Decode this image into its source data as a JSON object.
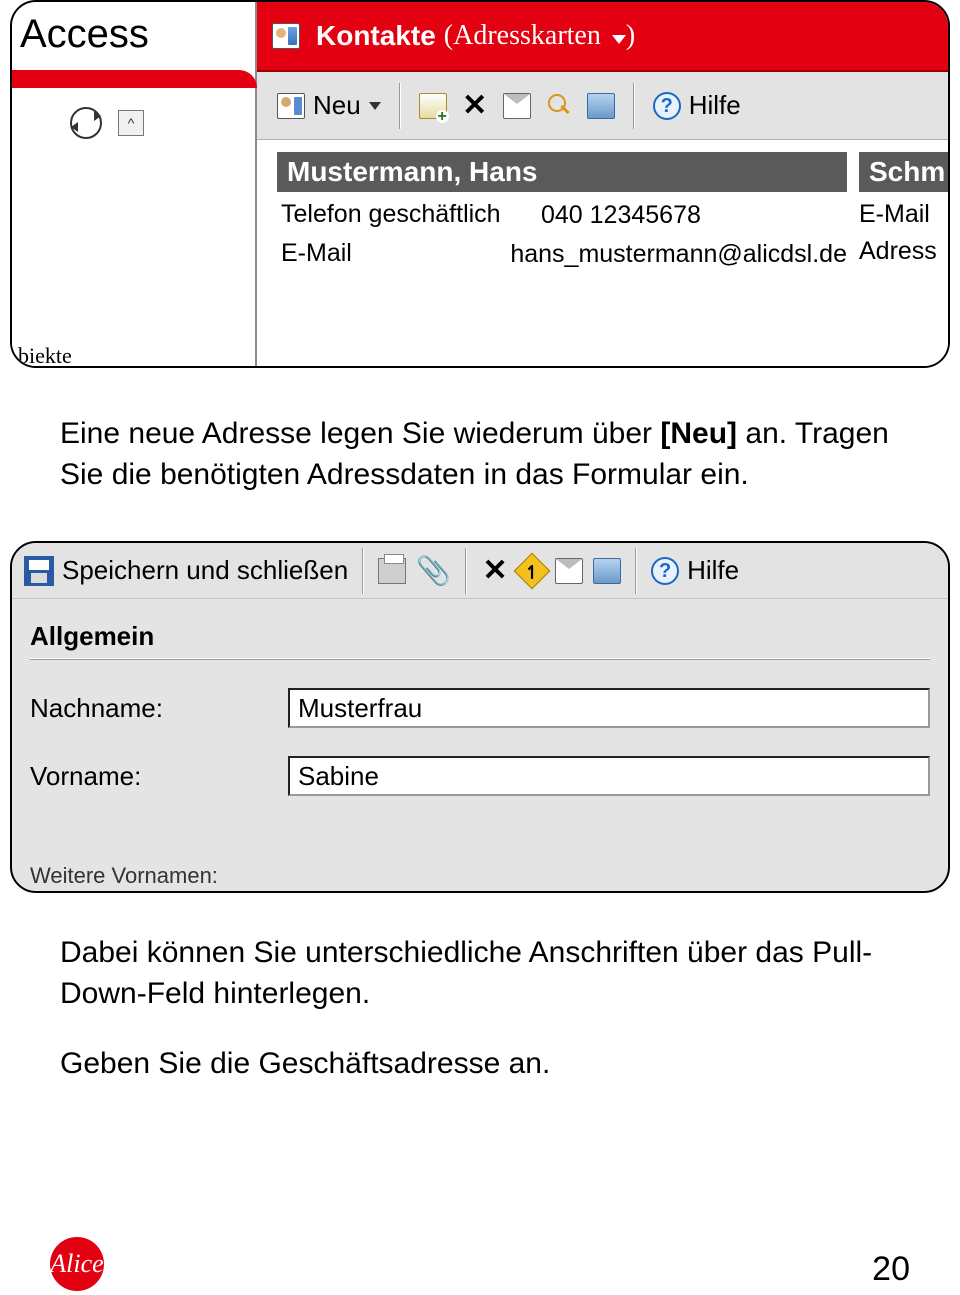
{
  "screenshot1": {
    "access_title": "Access",
    "kontakte_title": "Kontakte",
    "view_label": "Adresskarten",
    "toolbar": {
      "neu_label": "Neu",
      "hilfe_label": "Hilfe"
    },
    "access_bottom_text": "biekte",
    "card1": {
      "name": "Mustermann, Hans",
      "phone_label": "Telefon geschäftlich",
      "phone_value": "040 12345678",
      "email_label": "E-Mail",
      "email_value": "hans_mustermann@alicdsl.de"
    },
    "card2": {
      "name": "Schm",
      "email_label": "E-Mail",
      "address_label": "Adress"
    }
  },
  "paragraph1_a": "Eine neue Adresse legen Sie wiederum über ",
  "paragraph1_b": "[Neu]",
  "paragraph1_c": " an. Tragen Sie die benötigten Adressdaten in das Formular ein.",
  "screenshot2": {
    "toolbar": {
      "save_label": "Speichern und schließen",
      "hilfe_label": "Hilfe"
    },
    "tab_label": "Allgemein",
    "nachname_label": "Nachname:",
    "nachname_value": "Musterfrau",
    "vorname_label": "Vorname:",
    "vorname_value": "Sabine",
    "bottom_cut_label": "Weitere Vornamen:"
  },
  "paragraph2": "Dabei können Sie unterschiedliche Anschriften über das Pull-Down-Feld hinterlegen.",
  "paragraph3": "Geben Sie die Geschäftsadresse an.",
  "footer": {
    "brand": "Alice",
    "page_number": "20"
  }
}
